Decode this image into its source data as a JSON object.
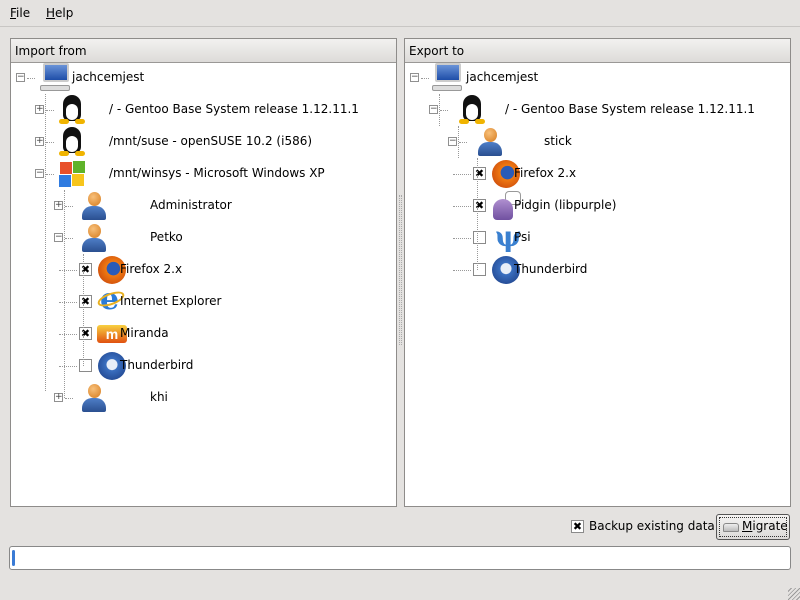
{
  "menu": {
    "file": "File",
    "help": "Help"
  },
  "import": {
    "title": "Import from",
    "rows": [
      {
        "depth": 0,
        "exp": "minus",
        "icon": "computer",
        "label": "jachcemjest"
      },
      {
        "depth": 1,
        "exp": "plus",
        "icon": "tux",
        "label": "/ - Gentoo Base System release 1.12.11.1"
      },
      {
        "depth": 1,
        "exp": "plus",
        "icon": "tux",
        "label": "/mnt/suse - openSUSE 10.2 (i586)"
      },
      {
        "depth": 1,
        "exp": "minus",
        "icon": "windows",
        "label": "/mnt/winsys - Microsoft Windows XP"
      },
      {
        "depth": 2,
        "exp": "plus",
        "icon": "user",
        "label": "Administrator"
      },
      {
        "depth": 2,
        "exp": "minus",
        "icon": "user",
        "label": "Petko"
      },
      {
        "depth": 3,
        "checked": true,
        "icon": "firefox",
        "label": "Firefox 2.x"
      },
      {
        "depth": 3,
        "checked": true,
        "icon": "ie",
        "label": "Internet Explorer"
      },
      {
        "depth": 3,
        "checked": true,
        "icon": "miranda",
        "label": "Miranda"
      },
      {
        "depth": 3,
        "checked": false,
        "icon": "thunderbird",
        "label": "Thunderbird"
      },
      {
        "depth": 2,
        "exp": "plus",
        "icon": "user",
        "label": "khi"
      }
    ]
  },
  "export": {
    "title": "Export to",
    "rows": [
      {
        "depth": 0,
        "exp": "minus",
        "icon": "computer",
        "label": "jachcemjest"
      },
      {
        "depth": 1,
        "exp": "minus",
        "icon": "tux",
        "label": "/ - Gentoo Base System release 1.12.11.1"
      },
      {
        "depth": 2,
        "exp": "minus",
        "icon": "user",
        "label": "stick"
      },
      {
        "depth": 3,
        "checked": true,
        "icon": "firefox",
        "label": "Firefox 2.x"
      },
      {
        "depth": 3,
        "checked": true,
        "icon": "pidgin",
        "label": "Pidgin (libpurple)"
      },
      {
        "depth": 3,
        "checked": false,
        "icon": "psi",
        "label": "Psi"
      },
      {
        "depth": 3,
        "checked": false,
        "icon": "thunderbird",
        "label": "Thunderbird"
      }
    ]
  },
  "backup": {
    "label": "Backup existing data",
    "checked": true
  },
  "migrate": {
    "label": "Migrate"
  },
  "progress": {
    "percent": 0
  }
}
